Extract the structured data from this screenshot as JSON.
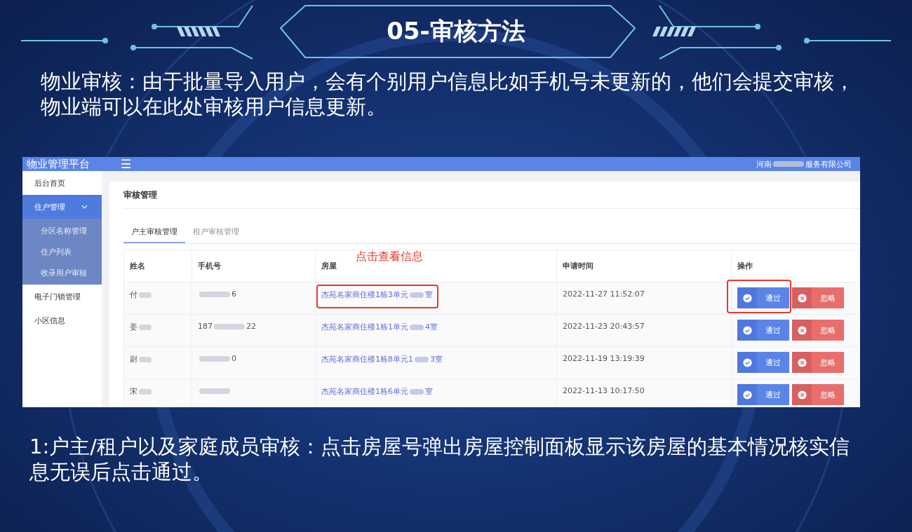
{
  "slide": {
    "title": "05-审核方法",
    "intro": "物业审核：由于批量导入用户，会有个别用户信息比如手机号未更新的，他们会提交审核，物业端可以在此处审核用户信息更新。",
    "note": "1:户主/租户以及家庭成员审核：点击房屋号弹出房屋控制面板显示该房屋的基本情况核实信息无误后点击通过。"
  },
  "app": {
    "brand": "物业管理平台",
    "menu_icon": "☰",
    "company_prefix": "河南",
    "company_suffix": "服务有限公司",
    "sidebar": [
      {
        "label": "后台首页",
        "selected": false
      },
      {
        "label": "住户管理",
        "selected": true,
        "expanded": true,
        "children": [
          {
            "label": "分区名称管理"
          },
          {
            "label": "住户列表"
          },
          {
            "label": "收录用户审核"
          }
        ]
      },
      {
        "label": "电子门锁管理",
        "selected": false
      },
      {
        "label": "小区信息",
        "selected": false
      }
    ],
    "page_title": "审核管理",
    "tabs": [
      {
        "label": "户主审核管理",
        "selected": true
      },
      {
        "label": "租户审核管理",
        "selected": false
      }
    ],
    "columns": [
      "姓名",
      "手机号",
      "房屋",
      "申请时间",
      "操作"
    ],
    "annotation": "点击查看信息",
    "rows": [
      {
        "name": "付",
        "phone_start": "",
        "phone_end": "6",
        "room_start": "杰苑名家商住楼1栋3单元",
        "room_end": "室",
        "time": "2022-11-27 11:52:07",
        "highlighted": true,
        "approve": "通过",
        "ignore": "忽略"
      },
      {
        "name": "姜",
        "phone_start": "187",
        "phone_end": "22",
        "room_start": "杰苑名家商住楼1栋1单元",
        "room_end": "4室",
        "time": "2022-11-23 20:43:57",
        "highlighted": false,
        "approve": "通过",
        "ignore": "忽略"
      },
      {
        "name": "尉",
        "phone_start": "",
        "phone_end": "0",
        "room_start": "杰苑名家商住楼1栋8单元1",
        "room_end": "3室",
        "time": "2022-11-19 13:19:39",
        "highlighted": false,
        "approve": "通过",
        "ignore": "忽略"
      },
      {
        "name": "宋",
        "phone_start": "",
        "phone_end": "",
        "room_start": "杰苑名家商住楼1栋6单元",
        "room_end": "室",
        "time": "2022-11-13 10:17:50",
        "highlighted": false,
        "approve": "通过",
        "ignore": "忽略"
      }
    ]
  }
}
